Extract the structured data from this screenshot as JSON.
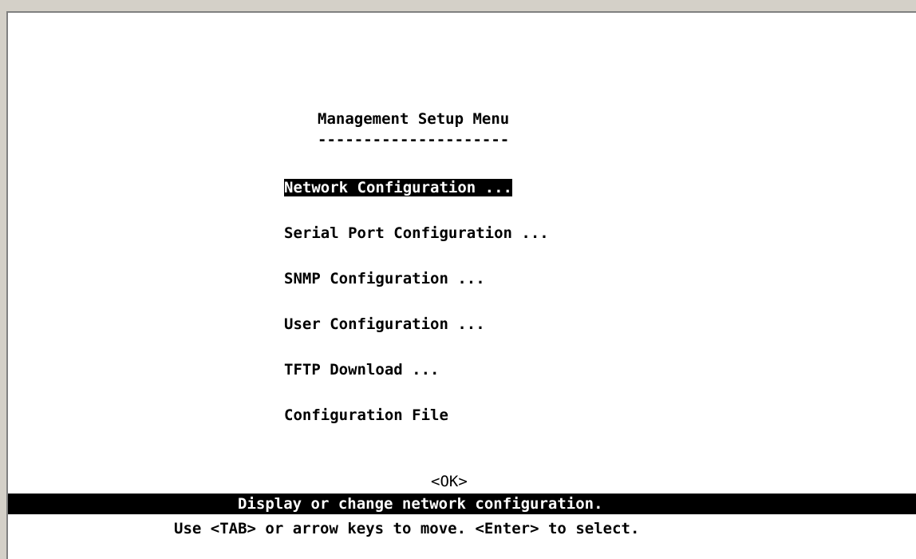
{
  "menu": {
    "title": "Management Setup Menu",
    "underline": "---------------------",
    "items": [
      {
        "label": "Network Configuration ...",
        "selected": true
      },
      {
        "label": "Serial Port Configuration ...",
        "selected": false
      },
      {
        "label": "SNMP Configuration ...",
        "selected": false
      },
      {
        "label": "User Configuration ...",
        "selected": false
      },
      {
        "label": "TFTP Download ...",
        "selected": false
      },
      {
        "label": "Configuration File",
        "selected": false
      }
    ]
  },
  "ok_label": "<OK>",
  "status": {
    "description": "Display or change network configuration.",
    "help": "Use <TAB> or arrow keys to move. <Enter> to select."
  },
  "colors": {
    "background": "#ffffff",
    "text": "#000000",
    "highlight_bg": "#000000",
    "highlight_fg": "#ffffff",
    "window_frame": "#d4d0c8"
  }
}
